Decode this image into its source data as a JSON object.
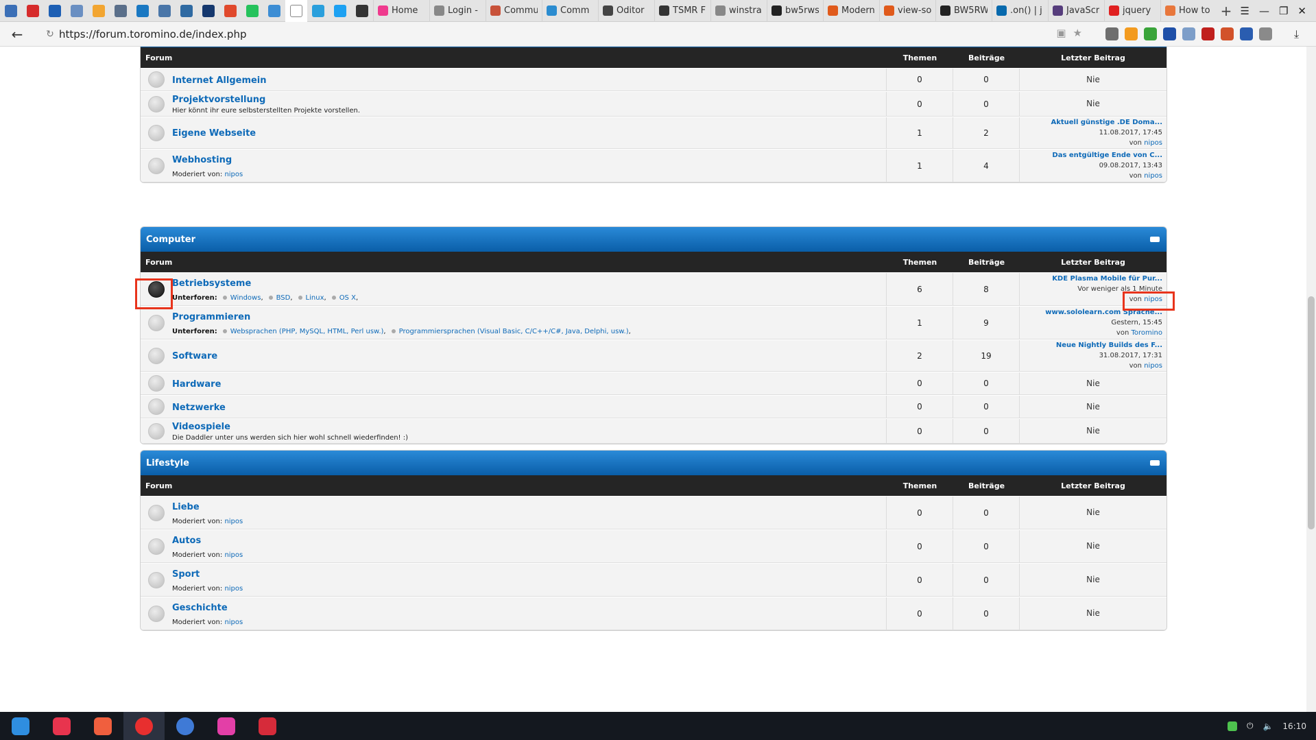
{
  "browser": {
    "pinned_tabs": [
      {
        "icon": "settings-app-icon",
        "color": "#3b6fb6"
      },
      {
        "icon": "pinterest-icon",
        "color": "#d62b2b"
      },
      {
        "icon": "bing-icon",
        "color": "#1d5fb4"
      },
      {
        "icon": "chart-icon",
        "color": "#6a8fc2"
      },
      {
        "icon": "s7-icon",
        "color": "#f2a531"
      },
      {
        "icon": "grid-icon",
        "color": "#5a6f8a"
      },
      {
        "icon": "document-icon",
        "color": "#1a78c2"
      },
      {
        "icon": "vk-icon",
        "color": "#4a76a8"
      },
      {
        "icon": "image-icon",
        "color": "#2f6aa2"
      },
      {
        "icon": "monitor-icon",
        "color": "#15386e"
      },
      {
        "icon": "gmail-icon",
        "color": "#e0492c"
      },
      {
        "icon": "whatsapp-icon",
        "color": "#25c25c"
      },
      {
        "icon": "chat-icon",
        "color": "#3c8dd4"
      },
      {
        "icon": "page-icon",
        "color": "#ffffff"
      },
      {
        "icon": "telegram-icon",
        "color": "#2a9fdc"
      },
      {
        "icon": "twitter-icon",
        "color": "#1da1f2"
      },
      {
        "icon": "tablet-icon",
        "color": "#333333"
      }
    ],
    "tabs": [
      {
        "label": "Home",
        "color": "#ef3a8e"
      },
      {
        "label": "Login -",
        "color": "#888888"
      },
      {
        "label": "Commu",
        "color": "#c8523a"
      },
      {
        "label": "Comm",
        "color": "#2b8cd0"
      },
      {
        "label": "Oditor",
        "color": "#444444"
      },
      {
        "label": "TSMR F",
        "color": "#333333"
      },
      {
        "label": "winstra",
        "color": "#888888"
      },
      {
        "label": "bw5rws",
        "color": "#222222"
      },
      {
        "label": "Modern",
        "color": "#e05a1b"
      },
      {
        "label": "view-so",
        "color": "#e05a1b"
      },
      {
        "label": "BW5RW",
        "color": "#222222"
      },
      {
        "label": ".on() | j",
        "color": "#0769ad"
      },
      {
        "label": "JavaScr",
        "color": "#563d7c"
      },
      {
        "label": "jquery",
        "color": "#e02020"
      },
      {
        "label": "How to",
        "color": "#e8773c"
      }
    ],
    "url": "https://forum.toromino.de/index.php",
    "extensions": [
      {
        "icon": "counter-70-icon",
        "color": "#6e6e6e"
      },
      {
        "icon": "weather-icon",
        "color": "#f39b1f"
      },
      {
        "icon": "leaf-icon",
        "color": "#3aa43a"
      },
      {
        "icon": "block-icon",
        "color": "#1e4fa8"
      },
      {
        "icon": "mail-icon",
        "color": "#7d9ec9"
      },
      {
        "icon": "shield-icon",
        "color": "#c0201d"
      },
      {
        "icon": "bug-icon",
        "color": "#d2522a"
      },
      {
        "icon": "n-icon",
        "color": "#2a5db0"
      },
      {
        "icon": "magnifier-icon",
        "color": "#8a8a8a"
      }
    ]
  },
  "col_headers": {
    "forum": "Forum",
    "themen": "Themen",
    "beitraege": "Beiträge",
    "letzter": "Letzter Beitrag"
  },
  "labels": {
    "moderiert": "Moderiert von:",
    "unterforen": "Unterforen:",
    "von": "von",
    "nie": "Nie"
  },
  "categories": [
    {
      "title": "",
      "forums": [
        {
          "title": "Internet Allgemein",
          "desc": "",
          "themen": "0",
          "beitraege": "0"
        },
        {
          "title": "Projektvorstellung",
          "desc": "Hier könnt ihr eure selbsterstellten Projekte vorstellen.",
          "themen": "0",
          "beitraege": "0"
        },
        {
          "title": "Eigene Webseite",
          "themen": "1",
          "beitraege": "2",
          "last": {
            "title": "Aktuell günstige .DE Doma...",
            "date": "11.08.2017, 17:45",
            "user": "nipos"
          }
        },
        {
          "title": "Webhosting",
          "moderator": "nipos",
          "themen": "1",
          "beitraege": "4",
          "last": {
            "title": "Das entgültige Ende von C...",
            "date": "09.08.2017, 13:43",
            "user": "nipos"
          }
        }
      ]
    },
    {
      "title": "Computer",
      "forums": [
        {
          "title": "Betriebsysteme",
          "subforums": [
            "Windows",
            "BSD",
            "Linux",
            "OS X"
          ],
          "themen": "6",
          "beitraege": "8",
          "last": {
            "title": "KDE Plasma Mobile für Pur...",
            "date": "Vor weniger als 1 Minute",
            "user": "nipos"
          }
        },
        {
          "title": "Programmieren",
          "subforums": [
            "Websprachen (PHP, MySQL, HTML, Perl usw.)",
            "Programmiersprachen (Visual Basic, C/C++/C#, Java, Delphi, usw.)"
          ],
          "themen": "1",
          "beitraege": "9",
          "last": {
            "title": "www.sololearn.com Sprache...",
            "date": "Gestern, 15:45",
            "user": "Toromino"
          }
        },
        {
          "title": "Software",
          "themen": "2",
          "beitraege": "19",
          "last": {
            "title": "Neue Nightly Builds des F...",
            "date": "31.08.2017, 17:31",
            "user": "nipos"
          }
        },
        {
          "title": "Hardware",
          "themen": "0",
          "beitraege": "0"
        },
        {
          "title": "Netzwerke",
          "themen": "0",
          "beitraege": "0"
        },
        {
          "title": "Videospiele",
          "desc": "Die Daddler unter uns werden sich hier wohl schnell wiederfinden! :)",
          "themen": "0",
          "beitraege": "0"
        }
      ]
    },
    {
      "title": "Lifestyle",
      "forums": [
        {
          "title": "Liebe",
          "moderator": "nipos",
          "themen": "0",
          "beitraege": "0"
        },
        {
          "title": "Autos",
          "moderator": "nipos",
          "themen": "0",
          "beitraege": "0"
        },
        {
          "title": "Sport",
          "moderator": "nipos",
          "themen": "0",
          "beitraege": "0"
        },
        {
          "title": "Geschichte",
          "moderator": "nipos",
          "themen": "0",
          "beitraege": "0"
        }
      ]
    }
  ],
  "taskbar": {
    "apps": [
      {
        "icon": "app-launcher-icon",
        "color": "#2f8ee0"
      },
      {
        "icon": "screenshot-icon",
        "color": "#e8344e"
      },
      {
        "icon": "screen-recorder-icon",
        "color": "#f05f3e"
      },
      {
        "icon": "yandex-browser-icon",
        "color": "#e82f2f"
      },
      {
        "icon": "globe-icon",
        "color": "#3f7ad6"
      },
      {
        "icon": "messenger-icon",
        "color": "#e33fa7"
      },
      {
        "icon": "terminal-icon",
        "color": "#d62b3a"
      }
    ],
    "clock": "16:10"
  }
}
